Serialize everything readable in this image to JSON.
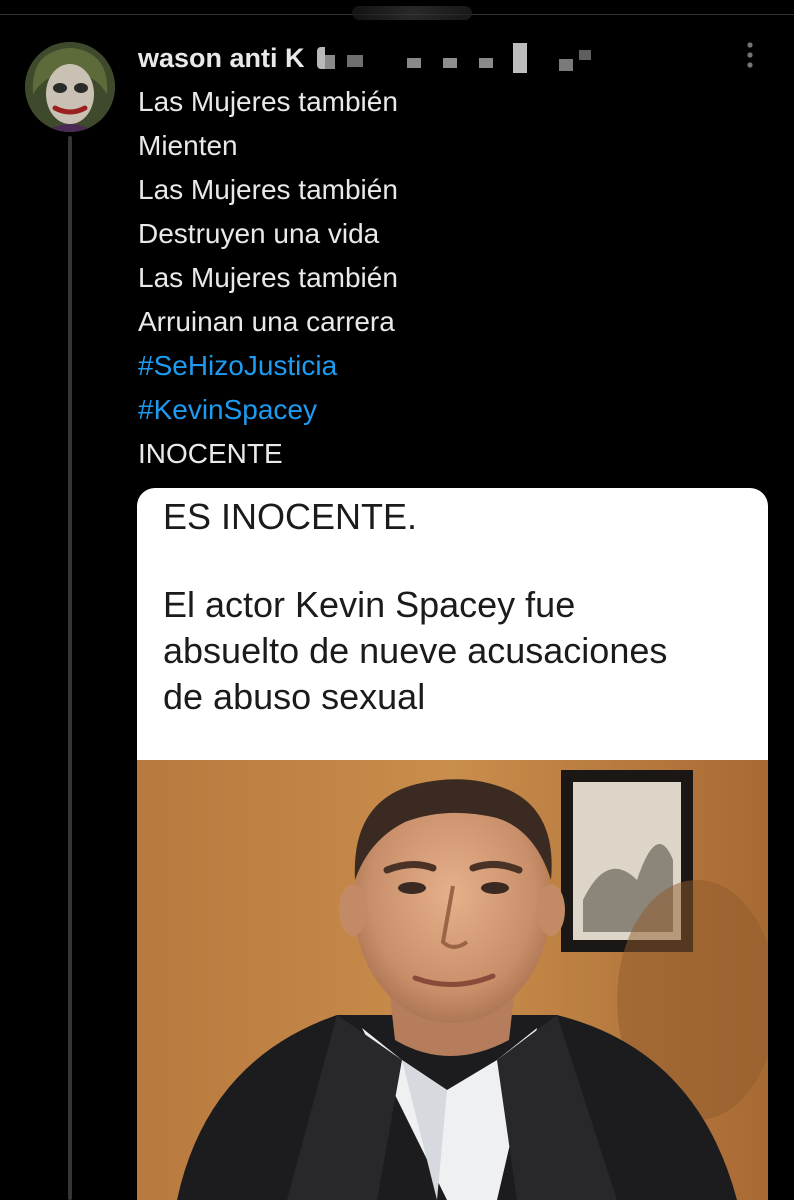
{
  "post": {
    "author": {
      "display_name": "wason anti K"
    },
    "text_lines": [
      {
        "text": "Las Mujeres también",
        "type": "text"
      },
      {
        "text": "Mienten",
        "type": "text"
      },
      {
        "text": "Las Mujeres también",
        "type": "text"
      },
      {
        "text": "Destruyen una vida",
        "type": "text"
      },
      {
        "text": "Las Mujeres también",
        "type": "text"
      },
      {
        "text": "Arruinan una carrera",
        "type": "text"
      },
      {
        "text": "#SeHizoJusticia",
        "type": "hashtag"
      },
      {
        "text": "#KevinSpacey",
        "type": "hashtag"
      },
      {
        "text": "INOCENTE",
        "type": "text"
      }
    ]
  },
  "media": {
    "headline": "ES INOCENTE.",
    "body_lines": [
      "El actor Kevin Spacey fue",
      "absuelto de nueve acusaciones",
      "de abuso sexual"
    ]
  },
  "icons": {
    "more": "more-vertical-icon",
    "avatar": "joker-avatar-image"
  },
  "colors": {
    "background": "#000000",
    "text": "#e7e9ea",
    "hashtag": "#1d9bf0",
    "thread_line": "#333639",
    "card_background": "#ffffff",
    "card_text": "#1b1b1b"
  }
}
